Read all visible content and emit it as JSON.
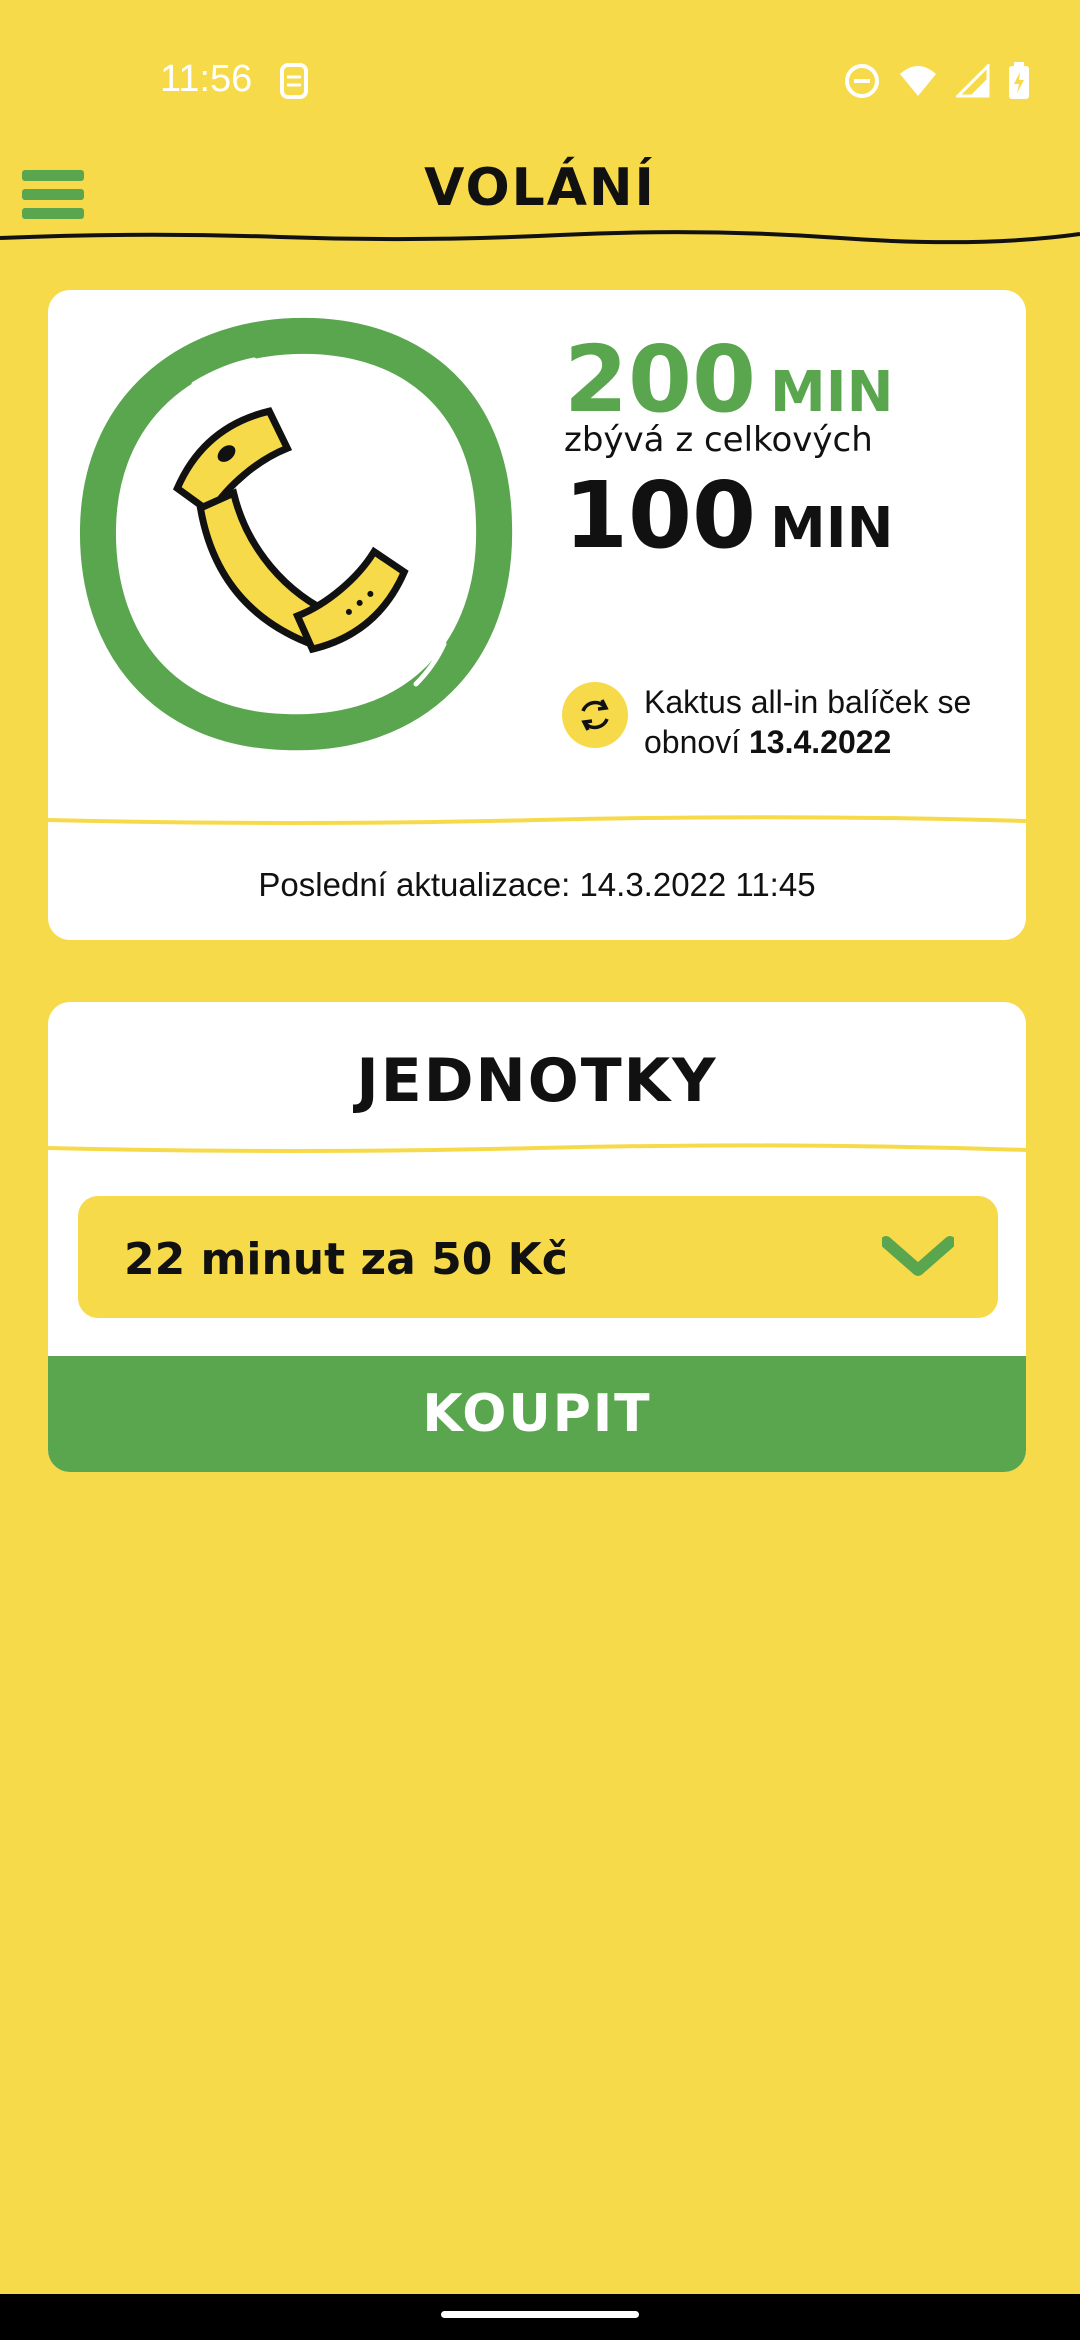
{
  "status_bar": {
    "time": "11:56",
    "icons": [
      "sim-icon",
      "dnd-icon",
      "wifi-icon",
      "signal-icon",
      "battery-charging-icon"
    ]
  },
  "header": {
    "title": "VOLÁNÍ",
    "menu_icon": "hamburger-menu-icon"
  },
  "usage_card": {
    "total_value": "200",
    "total_unit": "MIN",
    "subtitle": "zbývá z celkových",
    "remaining_value": "100",
    "remaining_unit": "MIN",
    "renew_text": "Kaktus all-in balíček se obnoví",
    "renew_date": "13.4.2022",
    "last_update": "Poslední aktualizace: 14.3.2022 11:45",
    "icons": [
      "phone-handset-icon",
      "refresh-icon"
    ]
  },
  "units_card": {
    "title": "JEDNOTKY",
    "selected_option": "22 minut za 50 Kč",
    "buy_label": "KOUPIT"
  },
  "colors": {
    "background": "#F7DA4A",
    "accent_green": "#5AA64F",
    "card": "#FFFFFF"
  }
}
